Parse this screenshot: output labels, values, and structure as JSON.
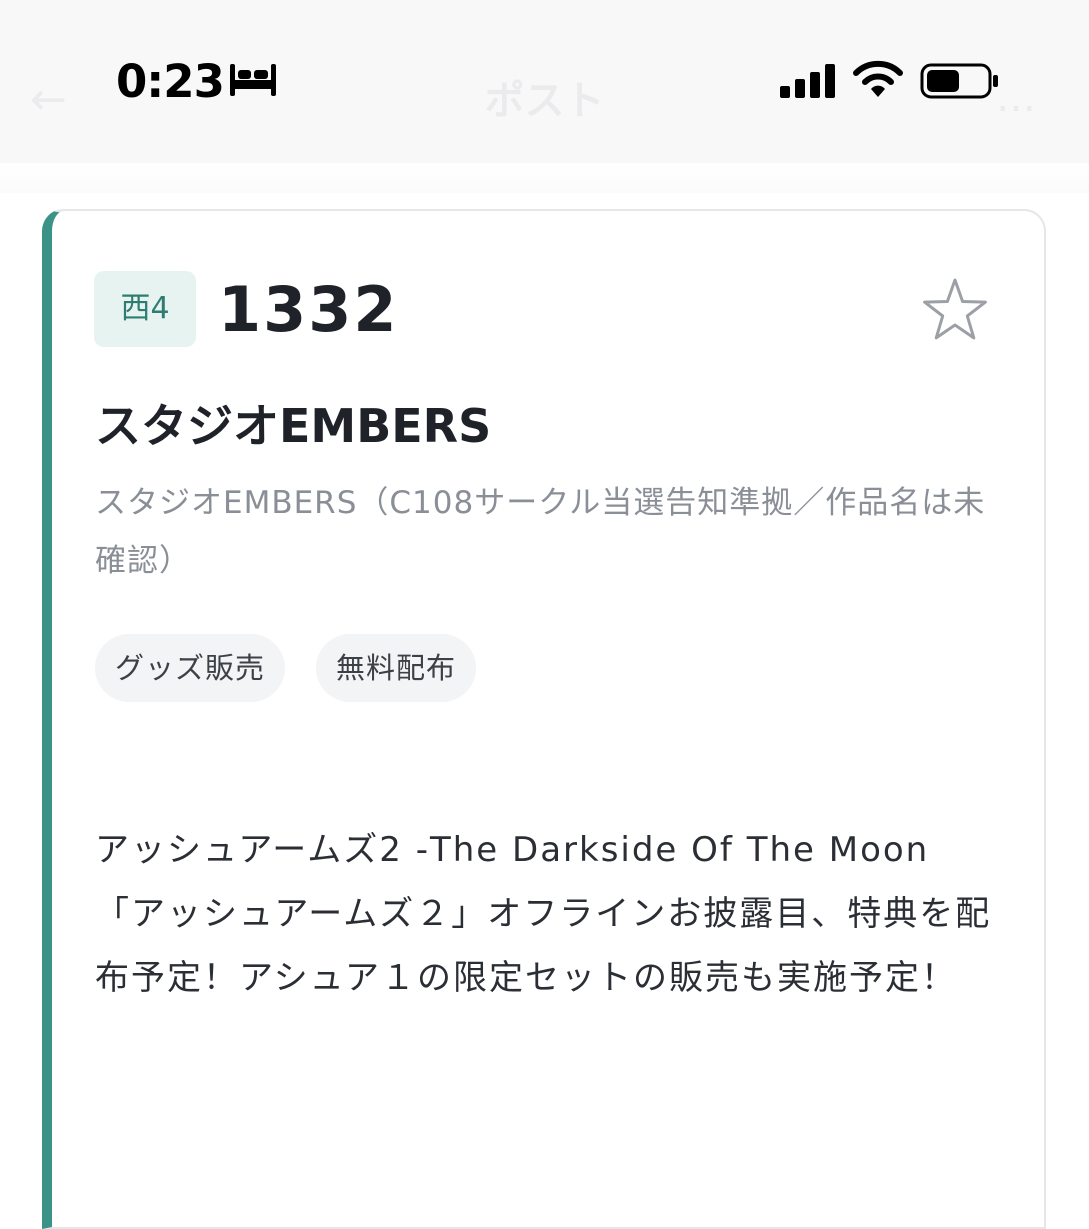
{
  "status_bar": {
    "time": "0:23",
    "icons": [
      "bed-icon",
      "signal-icon",
      "wifi-icon",
      "battery-icon"
    ]
  },
  "nav": {
    "back_glyph": "←",
    "title": "ポスト",
    "more_glyph": "…"
  },
  "colors": {
    "accent": "#3a9386",
    "badge_bg": "#e6f3f1",
    "badge_text": "#2e7d70",
    "muted_text": "#8a8f97"
  },
  "card": {
    "hall": "西4",
    "space_number": "1332",
    "star_glyph": "☆",
    "circle_name": "スタジオEMBERS",
    "circle_note": "スタジオEMBERS（C108サークル当選告知準拠／作品名は未確認）",
    "tags": [
      "グッズ販売",
      "無料配布"
    ],
    "description": "アッシュアームズ2 -The Darkside Of The Moon 「アッシュアームズ２」オフラインお披露目、特典を配布予定！アシュア１の限定セットの販売も実施予定！"
  }
}
